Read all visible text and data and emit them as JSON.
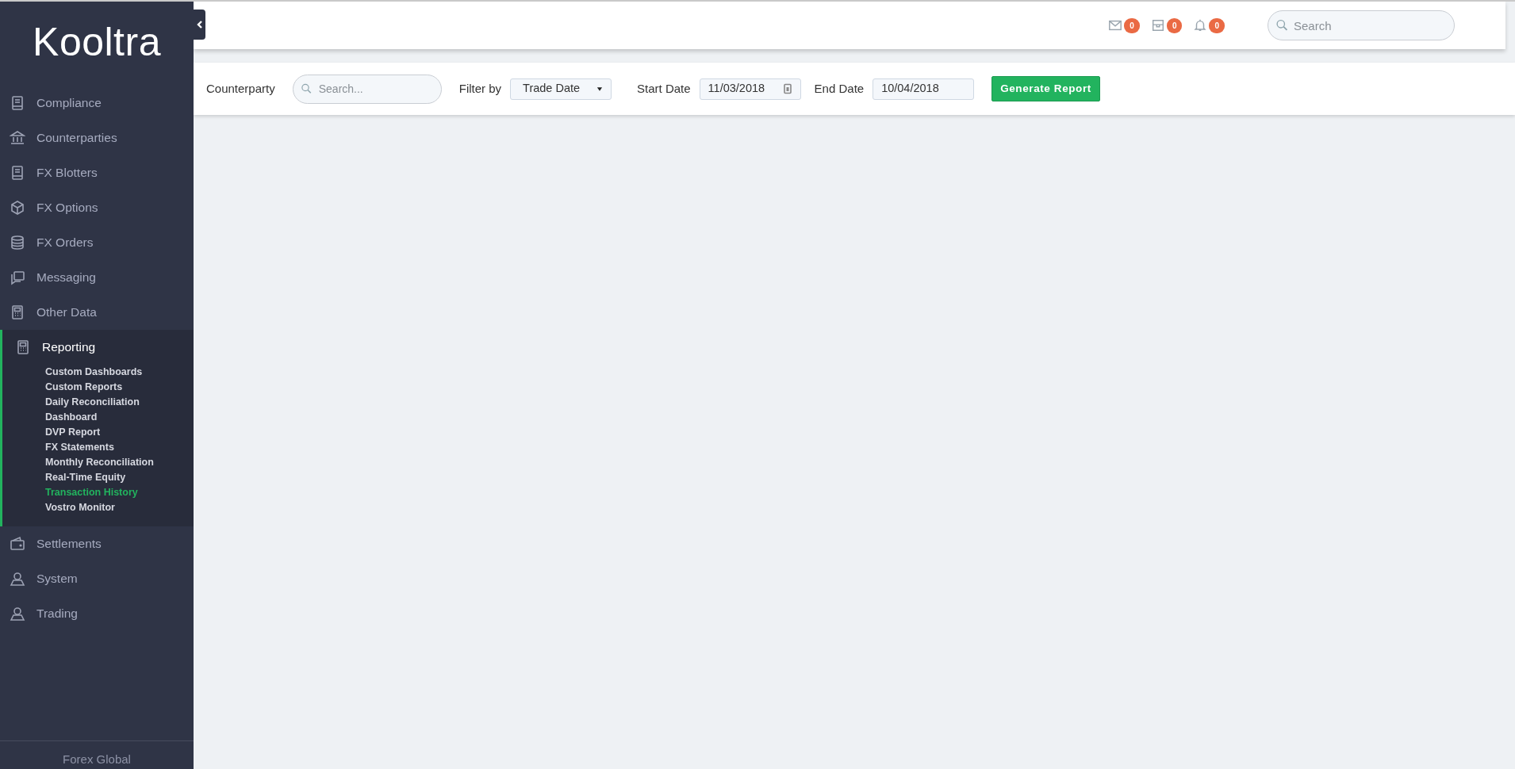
{
  "sidebar": {
    "logo": "Kooltra",
    "items": [
      {
        "label": "Compliance",
        "expanded": false
      },
      {
        "label": "Counterparties",
        "expanded": false
      },
      {
        "label": "FX Blotters",
        "expanded": false
      },
      {
        "label": "FX Options",
        "expanded": false
      },
      {
        "label": "FX Orders",
        "expanded": false
      },
      {
        "label": "Messaging",
        "expanded": false
      },
      {
        "label": "Other Data",
        "expanded": false
      },
      {
        "label": "Reporting",
        "expanded": true,
        "children": [
          {
            "label": "Custom Dashboards",
            "selected": false
          },
          {
            "label": "Custom Reports",
            "selected": false
          },
          {
            "label": "Daily Reconciliation",
            "selected": false
          },
          {
            "label": "Dashboard",
            "selected": false
          },
          {
            "label": "DVP Report",
            "selected": false
          },
          {
            "label": "FX Statements",
            "selected": false
          },
          {
            "label": "Monthly Reconciliation",
            "selected": false
          },
          {
            "label": "Real-Time Equity",
            "selected": false
          },
          {
            "label": "Transaction History",
            "selected": true
          },
          {
            "label": "Vostro Monitor",
            "selected": false
          }
        ]
      },
      {
        "label": "Settlements",
        "expanded": false
      },
      {
        "label": "System",
        "expanded": false
      },
      {
        "label": "Trading",
        "expanded": false
      }
    ],
    "footer": "Forex Global"
  },
  "topbar": {
    "badges": [
      "0",
      "0",
      "0"
    ],
    "search": {
      "placeholder": "Search"
    }
  },
  "filters": {
    "counterparty_label": "Counterparty",
    "counterparty_search": {
      "placeholder": "Search..."
    },
    "filter_label": "Filter by",
    "filter_value": "Trade Date",
    "start_label": "Start Date",
    "start_value": "11/03/2018",
    "end_label": "End Date",
    "end_value": "10/04/2018",
    "button": "Generate Report"
  }
}
